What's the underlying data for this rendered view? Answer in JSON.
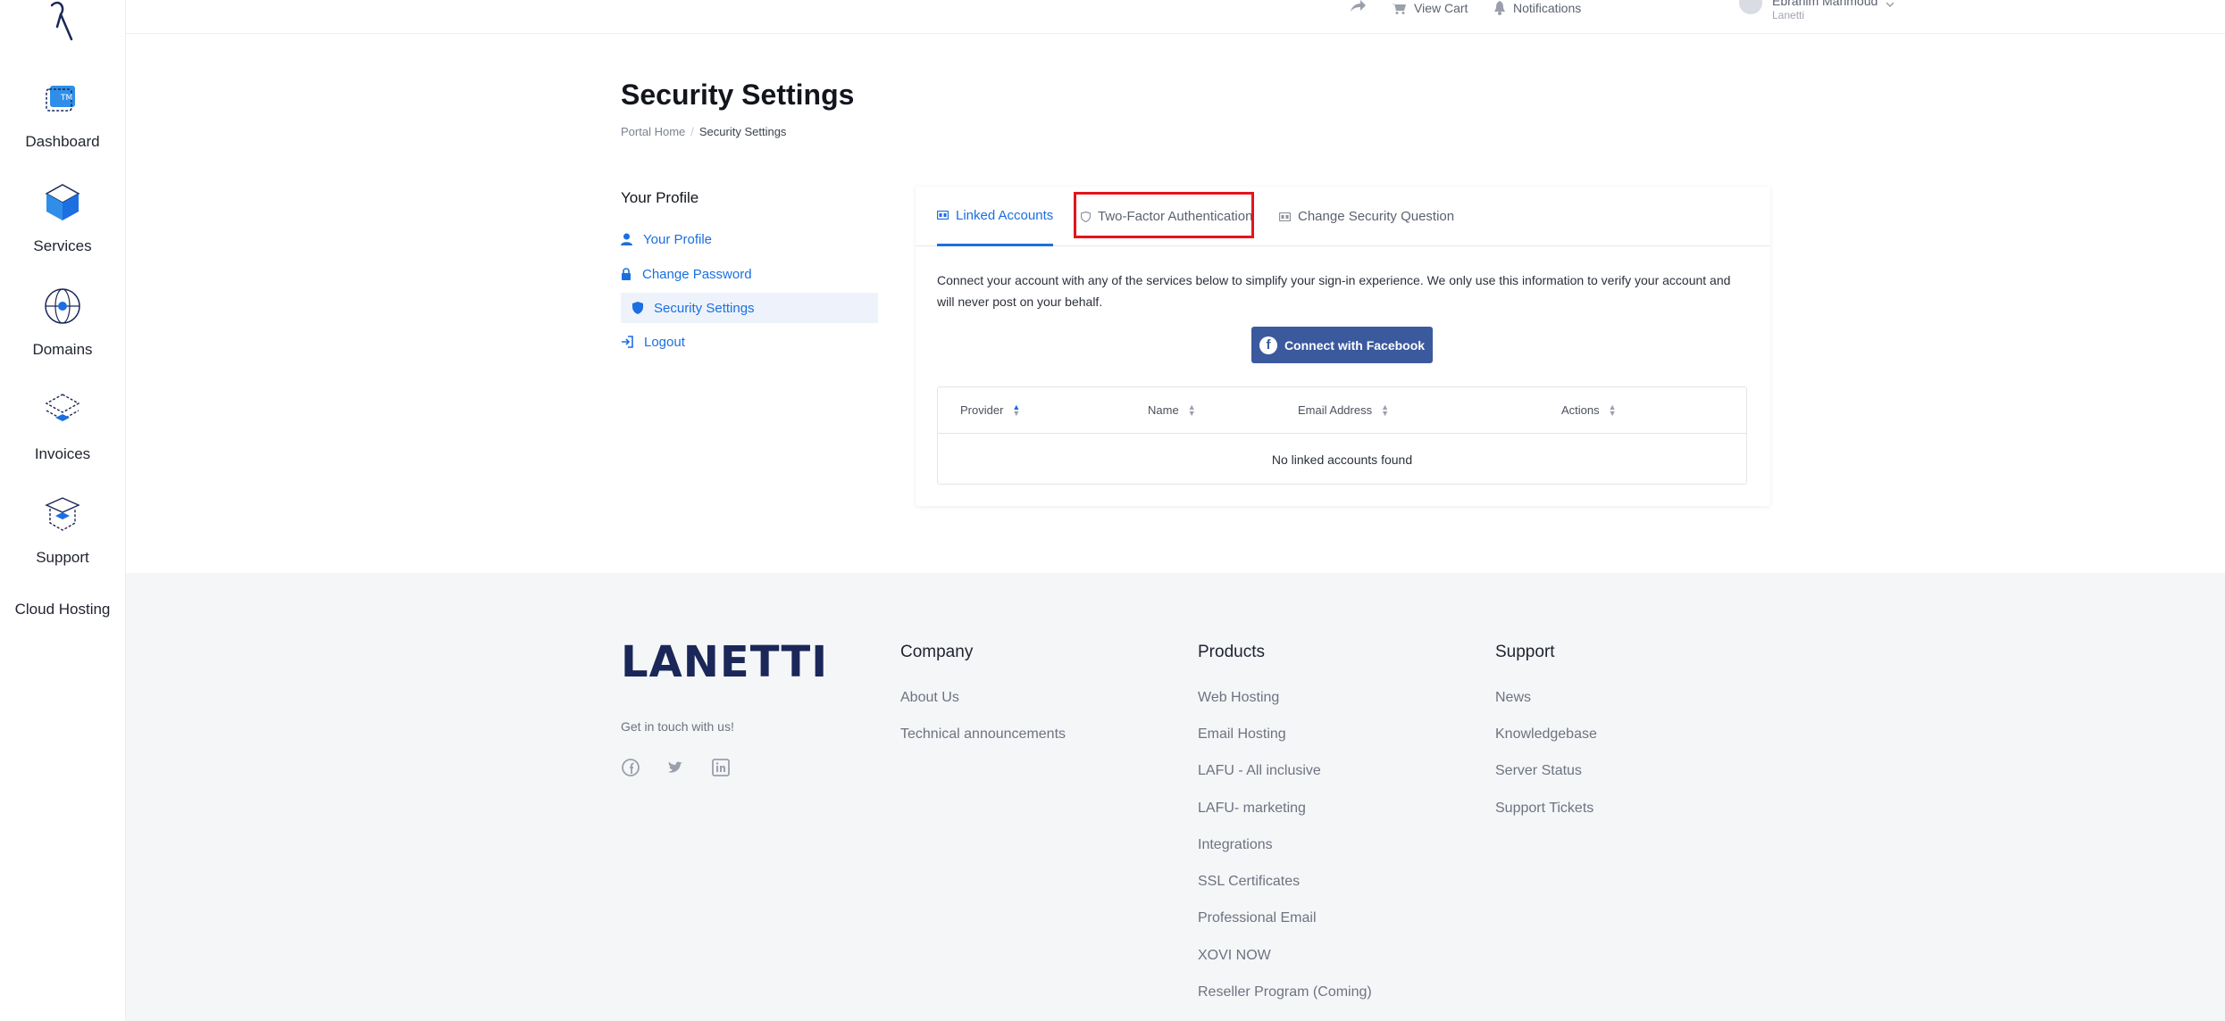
{
  "colors": {
    "accent": "#1b6fe0",
    "facebook": "#3b5a9e",
    "highlight": "#e4141c",
    "brand": "#1a2758"
  },
  "sidebar": {
    "items": [
      {
        "label": "Dashboard",
        "icon": "dashboard-icon"
      },
      {
        "label": "Services",
        "icon": "services-cube-icon"
      },
      {
        "label": "Domains",
        "icon": "globe-icon"
      },
      {
        "label": "Invoices",
        "icon": "invoices-icon"
      },
      {
        "label": "Support",
        "icon": "support-icon"
      }
    ],
    "extra": "Cloud Hosting"
  },
  "topbar": {
    "view_cart": "View Cart",
    "notifications": "Notifications",
    "user_name": "Ebrahim Mahmoud",
    "user_company": "Lanetti"
  },
  "header": {
    "title": "Security Settings",
    "breadcrumb": [
      "Portal Home",
      "Security Settings"
    ]
  },
  "profile_nav": {
    "title": "Your Profile",
    "links": [
      "Your Profile",
      "Change Password",
      "Security Settings",
      "Logout"
    ],
    "active": "Security Settings"
  },
  "tabs": [
    "Linked Accounts",
    "Two-Factor Authentication",
    "Change Security Question"
  ],
  "active_tab": "Linked Accounts",
  "linked": {
    "description": "Connect your account with any of the services below to simplify your sign-in experience. We only use this information to verify your account and will never post on your behalf.",
    "facebook_button": "Connect with Facebook",
    "columns": [
      "Provider",
      "Name",
      "Email Address",
      "Actions"
    ],
    "empty": "No linked accounts found"
  },
  "footer": {
    "brand": "LANETTI",
    "tagline": "Get in touch with us!",
    "columns": [
      {
        "title": "Company",
        "links": [
          "About Us",
          "Technical announcements"
        ]
      },
      {
        "title": "Products",
        "links": [
          "Web Hosting",
          "Email Hosting",
          "LAFU - All inclusive",
          "LAFU- marketing",
          "Integrations",
          "SSL Certificates",
          "Professional Email",
          "XOVI NOW",
          "Reseller Program (Coming)"
        ]
      },
      {
        "title": "Support",
        "links": [
          "News",
          "Knowledgebase",
          "Server Status",
          "Support Tickets"
        ]
      }
    ]
  }
}
